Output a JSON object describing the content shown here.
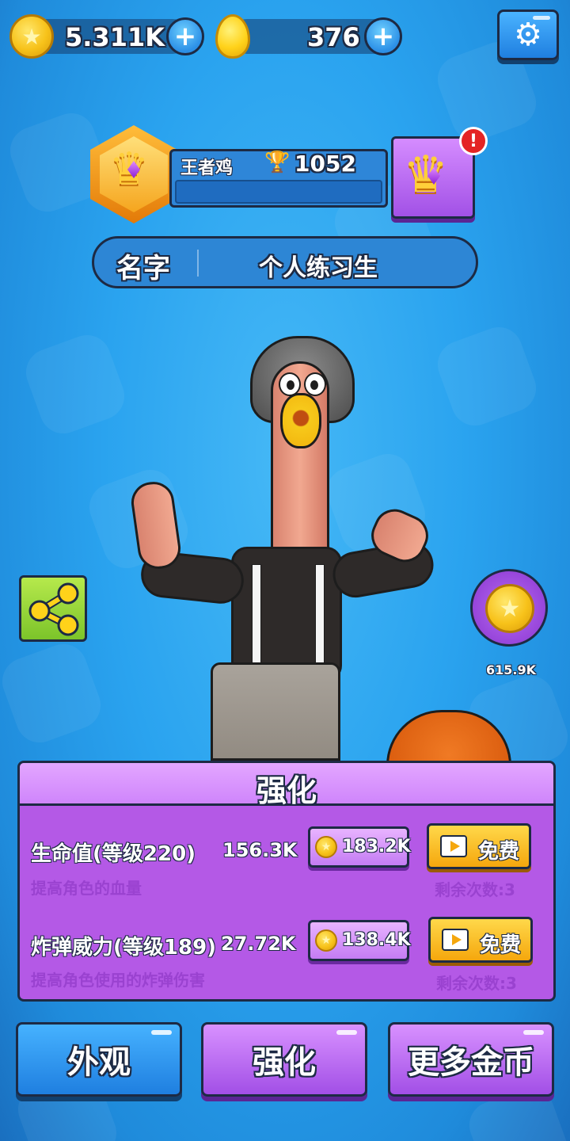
{
  "currency": {
    "gold": "5.311K",
    "eggs": "376",
    "plus_label": "+"
  },
  "icons": {
    "settings": "gear-icon",
    "share": "share-icon",
    "trophy": "trophy-icon",
    "crown": "crown-icon",
    "coin": "coin-icon",
    "alert": "!"
  },
  "profile": {
    "rank_title": "王者鸡",
    "trophies": "1052",
    "name_label": "名字",
    "name_value": "个人练习生"
  },
  "reward": {
    "coin_amount": "615.9K"
  },
  "upgrade_panel": {
    "title": "强化",
    "stats": [
      {
        "name": "生命值(等级220)",
        "value": "156.3K",
        "cost": "183.2K",
        "free_label": "免费",
        "description": "提高角色的血量",
        "remaining": "剩余次数:3"
      },
      {
        "name": "炸弹威力(等级189)",
        "value": "27.72K",
        "cost": "138.4K",
        "free_label": "免费",
        "description": "提高角色使用的炸弹伤害",
        "remaining": "剩余次数:3"
      }
    ]
  },
  "tabs": [
    {
      "label": "外观"
    },
    {
      "label": "强化"
    },
    {
      "label": "更多金币"
    }
  ],
  "colors": {
    "background": "#2aa3ef",
    "panel": "#b459e6",
    "tab_blue": "#1f7fe0",
    "tab_purple": "#a24fe6",
    "free_button": "#f5a70d"
  }
}
